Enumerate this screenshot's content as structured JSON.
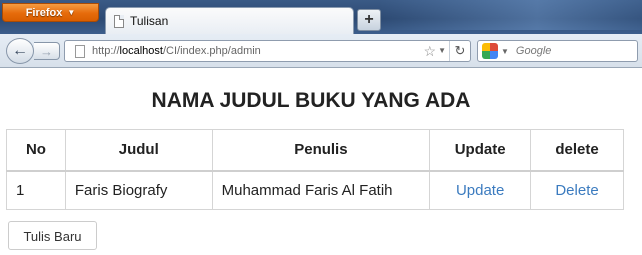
{
  "browser": {
    "app_button_label": "Firefox",
    "tab_title": "Tulisan",
    "new_tab_label": "+",
    "url_prefix": "http://",
    "url_host": "localhost",
    "url_path": "/CI/index.php/admin",
    "search_placeholder": "Google"
  },
  "page": {
    "title": "NAMA JUDUL BUKU YANG ADA",
    "table": {
      "headers": [
        "No",
        "Judul",
        "Penulis",
        "Update",
        "delete"
      ],
      "rows": [
        {
          "no": "1",
          "judul": "Faris Biografy",
          "penulis": "Muhammad Faris Al Fatih",
          "update": "Update",
          "delete": "Delete"
        }
      ]
    },
    "new_button_label": "Tulis Baru"
  }
}
